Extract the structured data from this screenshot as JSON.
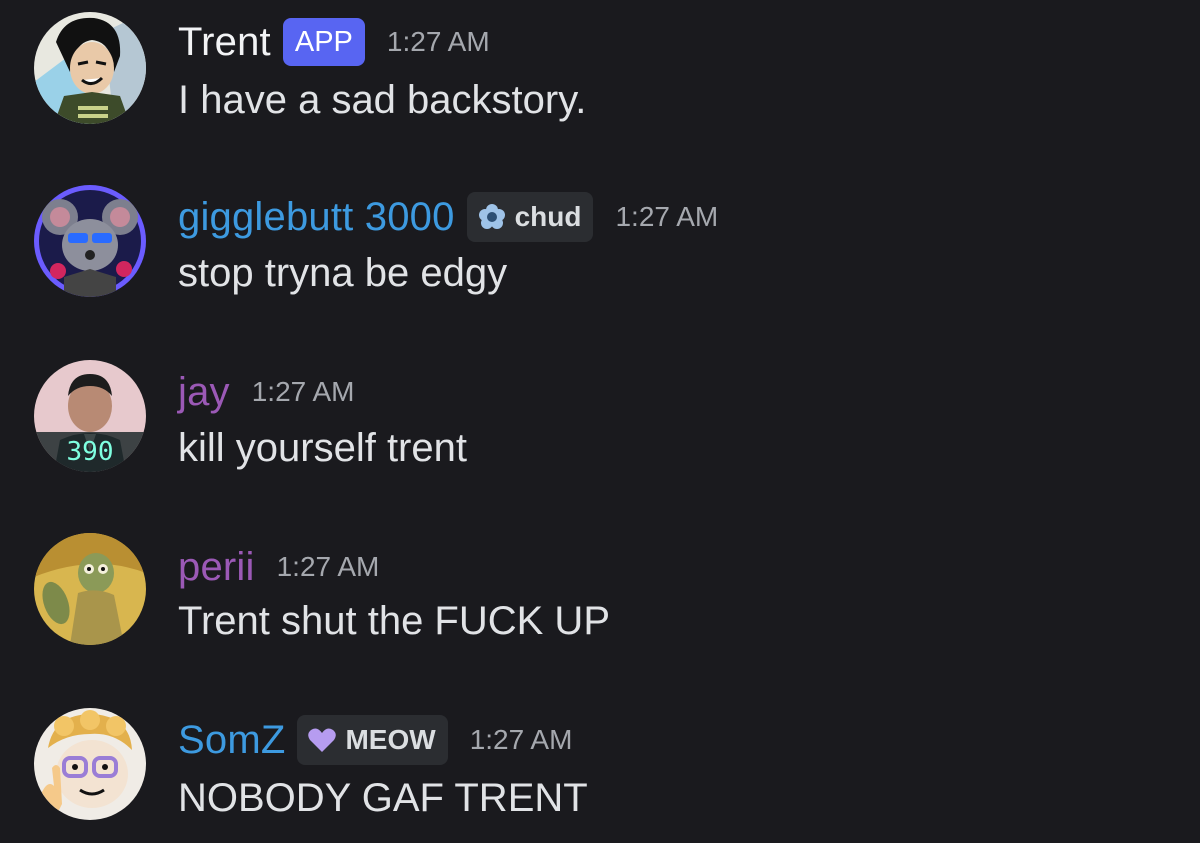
{
  "messages": [
    {
      "username": "Trent",
      "username_color": "#f2f3f5",
      "badge": "APP",
      "timestamp": "1:27 AM",
      "text": "I have a sad backstory.",
      "avatar": "cartoon-character-avatar"
    },
    {
      "username": "gigglebutt 3000",
      "username_color": "#3d9ae0",
      "tag": "chud",
      "tag_icon": "flower-icon",
      "timestamp": "1:27 AM",
      "text": "stop tryna be edgy",
      "avatar": "mouse-character-avatar"
    },
    {
      "username": "jay",
      "username_color": "#9b59b6",
      "timestamp": "1:27 AM",
      "text": "kill yourself trent",
      "avatar": "player-portrait-avatar",
      "avatar_number": "390"
    },
    {
      "username": "perii",
      "username_color": "#9b59b6",
      "timestamp": "1:27 AM",
      "text": "Trent shut the FUCK UP",
      "avatar": "green-creature-avatar"
    },
    {
      "username": "SomZ",
      "username_color": "#3d9ae0",
      "tag": "MEOW",
      "tag_icon": "purple-heart-icon",
      "timestamp": "1:27 AM",
      "text": "NOBODY GAF TRENT",
      "avatar": "glasses-character-avatar"
    }
  ]
}
